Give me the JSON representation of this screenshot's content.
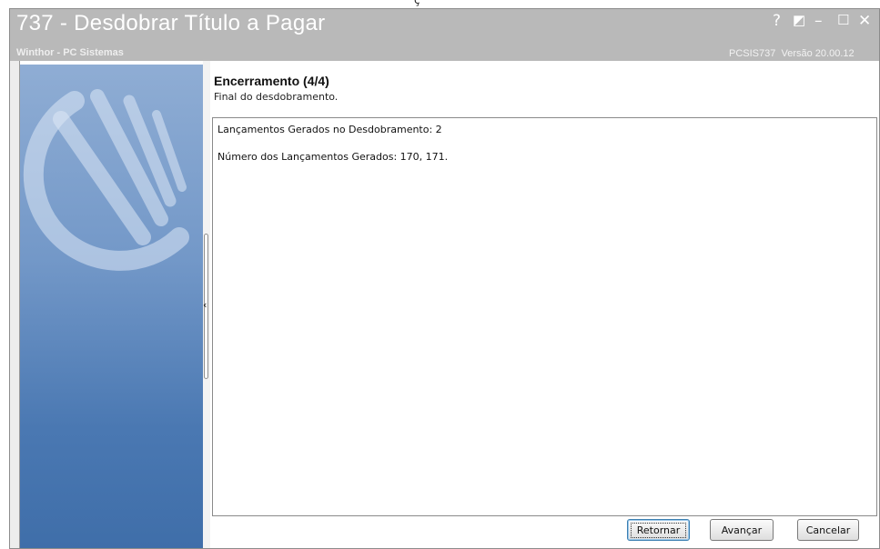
{
  "top_fragment": "ç",
  "window": {
    "title": "737 - Desdobrar Título a Pagar",
    "subtitle": "Winthor - PC Sistemas",
    "code": "PCSIS737",
    "version": "Versão 20.00.12",
    "controls": {
      "help": "?",
      "restore": "◩",
      "minimize": "–",
      "maximize": "☐",
      "close": "✕"
    }
  },
  "step": {
    "title": "Encerramento (4/4)",
    "subtitle": "Final do desdobramento."
  },
  "content": {
    "lines": [
      "Lançamentos Gerados no Desdobramento: 2",
      "Número dos Lançamentos Gerados: 170, 171."
    ]
  },
  "splitter": {
    "arrow": "‹"
  },
  "buttons": {
    "back": "Retornar",
    "next": "Avançar",
    "cancel": "Cancelar"
  },
  "colors": {
    "titlebar": "#b9b9b9",
    "sidebar_top": "#8fadd4",
    "sidebar_bottom": "#3f6ea9"
  }
}
